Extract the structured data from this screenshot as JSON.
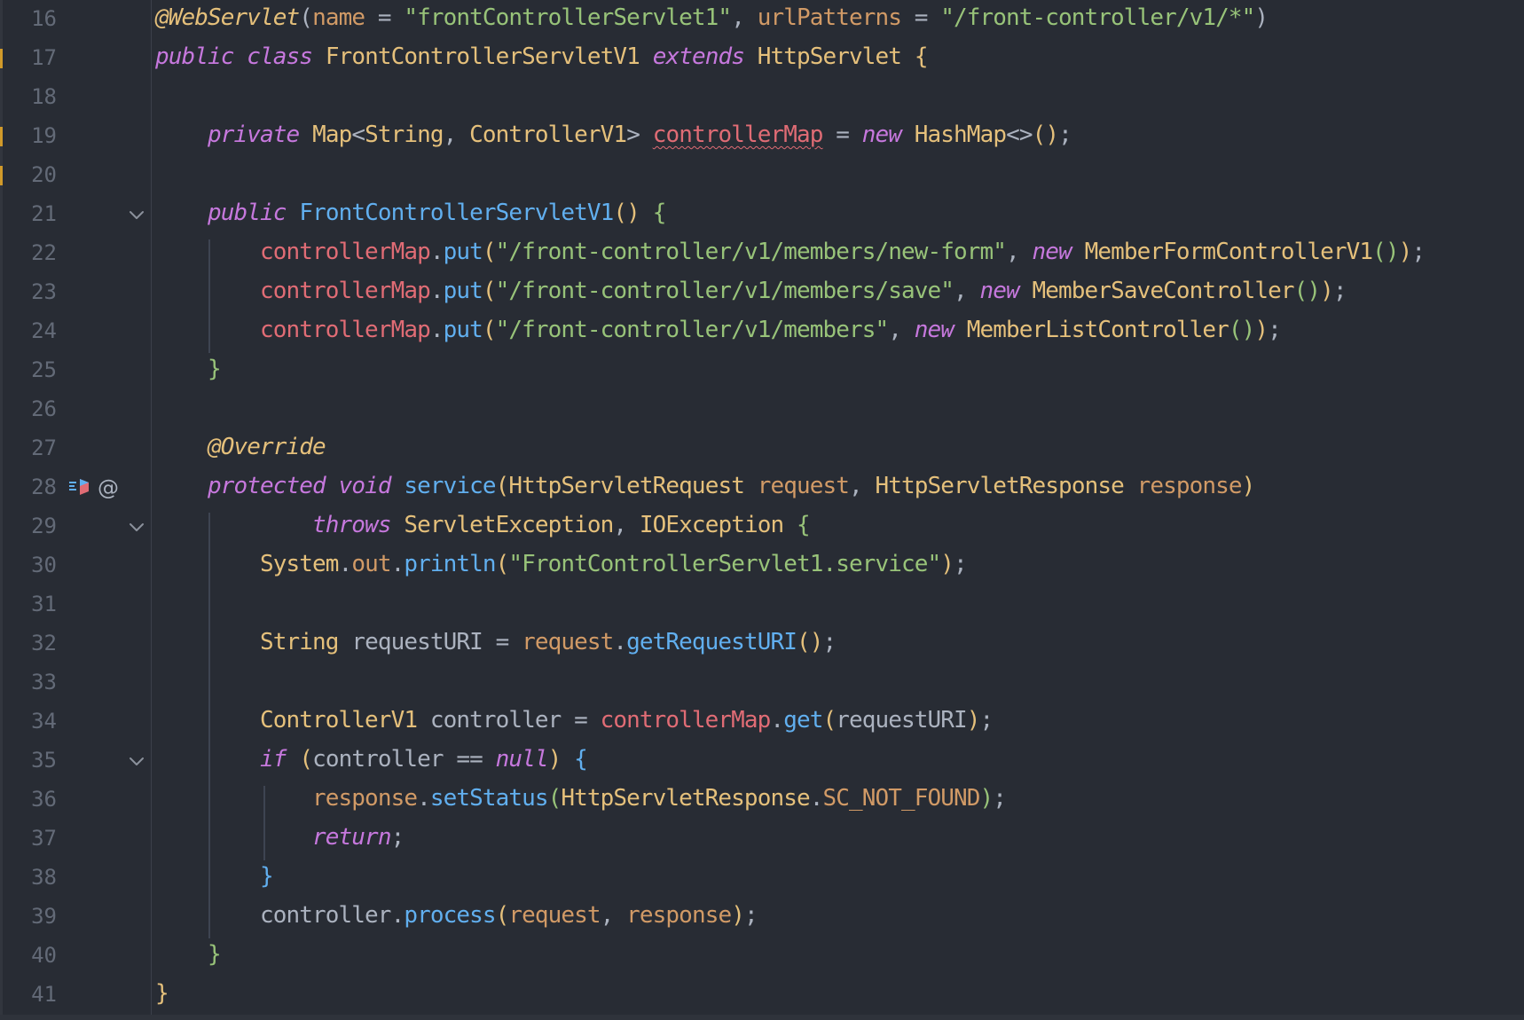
{
  "editor": {
    "language": "Java",
    "colors": {
      "background": "#282c34",
      "keyword": "#c678dd",
      "string": "#98c379",
      "class": "#e5c07b",
      "field": "#e06c75",
      "method": "#61afef",
      "parameter": "#d19a66",
      "line_number": "#636a77"
    },
    "lines": [
      {
        "number": "16",
        "tokens": [
          {
            "t": "@WebServlet",
            "c": "ann"
          },
          {
            "t": "(",
            "c": "plain"
          },
          {
            "t": "name",
            "c": "prm"
          },
          {
            "t": " = ",
            "c": "plain"
          },
          {
            "t": "\"frontControllerServlet1\"",
            "c": "str"
          },
          {
            "t": ", ",
            "c": "plain"
          },
          {
            "t": "urlPatterns",
            "c": "prm"
          },
          {
            "t": " = ",
            "c": "plain"
          },
          {
            "t": "\"/front-controller/v1/*\"",
            "c": "str"
          },
          {
            "t": ")",
            "c": "plain"
          }
        ]
      },
      {
        "number": "17",
        "tokens": [
          {
            "t": "public",
            "c": "kw"
          },
          {
            "t": " ",
            "c": "plain"
          },
          {
            "t": "class",
            "c": "kw"
          },
          {
            "t": " ",
            "c": "plain"
          },
          {
            "t": "FrontControllerServletV1",
            "c": "cls"
          },
          {
            "t": " ",
            "c": "plain"
          },
          {
            "t": "extends",
            "c": "kw"
          },
          {
            "t": " ",
            "c": "plain"
          },
          {
            "t": "HttpServlet",
            "c": "cls"
          },
          {
            "t": " ",
            "c": "plain"
          },
          {
            "t": "{",
            "c": "br1"
          }
        ]
      },
      {
        "number": "18",
        "tokens": []
      },
      {
        "number": "19",
        "tokens": [
          {
            "t": "    ",
            "c": "plain"
          },
          {
            "t": "private",
            "c": "kw"
          },
          {
            "t": " ",
            "c": "plain"
          },
          {
            "t": "Map",
            "c": "cls"
          },
          {
            "t": "<",
            "c": "plain"
          },
          {
            "t": "String",
            "c": "cls"
          },
          {
            "t": ", ",
            "c": "plain"
          },
          {
            "t": "ControllerV1",
            "c": "cls"
          },
          {
            "t": "> ",
            "c": "plain"
          },
          {
            "t": "controllerMap",
            "c": "fld squiggle"
          },
          {
            "t": " = ",
            "c": "plain"
          },
          {
            "t": "new",
            "c": "kw"
          },
          {
            "t": " ",
            "c": "plain"
          },
          {
            "t": "HashMap",
            "c": "cls"
          },
          {
            "t": "<>",
            "c": "plain"
          },
          {
            "t": "()",
            "c": "br1"
          },
          {
            "t": ";",
            "c": "plain"
          }
        ]
      },
      {
        "number": "20",
        "tokens": []
      },
      {
        "number": "21",
        "tokens": [
          {
            "t": "    ",
            "c": "plain"
          },
          {
            "t": "public",
            "c": "kw"
          },
          {
            "t": " ",
            "c": "plain"
          },
          {
            "t": "FrontControllerServletV1",
            "c": "fn"
          },
          {
            "t": "()",
            "c": "br1"
          },
          {
            "t": " ",
            "c": "plain"
          },
          {
            "t": "{",
            "c": "br2"
          }
        ]
      },
      {
        "number": "22",
        "tokens": [
          {
            "t": "        ",
            "c": "plain"
          },
          {
            "t": "controllerMap",
            "c": "fld"
          },
          {
            "t": ".",
            "c": "plain"
          },
          {
            "t": "put",
            "c": "fn"
          },
          {
            "t": "(",
            "c": "br1"
          },
          {
            "t": "\"/front-controller/v1/members/new-form\"",
            "c": "str"
          },
          {
            "t": ", ",
            "c": "plain"
          },
          {
            "t": "new",
            "c": "kw"
          },
          {
            "t": " ",
            "c": "plain"
          },
          {
            "t": "MemberFormControllerV1",
            "c": "cls"
          },
          {
            "t": "()",
            "c": "br2"
          },
          {
            "t": ")",
            "c": "br1"
          },
          {
            "t": ";",
            "c": "plain"
          }
        ]
      },
      {
        "number": "23",
        "tokens": [
          {
            "t": "        ",
            "c": "plain"
          },
          {
            "t": "controllerMap",
            "c": "fld"
          },
          {
            "t": ".",
            "c": "plain"
          },
          {
            "t": "put",
            "c": "fn"
          },
          {
            "t": "(",
            "c": "br1"
          },
          {
            "t": "\"/front-controller/v1/members/save\"",
            "c": "str"
          },
          {
            "t": ", ",
            "c": "plain"
          },
          {
            "t": "new",
            "c": "kw"
          },
          {
            "t": " ",
            "c": "plain"
          },
          {
            "t": "MemberSaveController",
            "c": "cls"
          },
          {
            "t": "()",
            "c": "br2"
          },
          {
            "t": ")",
            "c": "br1"
          },
          {
            "t": ";",
            "c": "plain"
          }
        ]
      },
      {
        "number": "24",
        "tokens": [
          {
            "t": "        ",
            "c": "plain"
          },
          {
            "t": "controllerMap",
            "c": "fld"
          },
          {
            "t": ".",
            "c": "plain"
          },
          {
            "t": "put",
            "c": "fn"
          },
          {
            "t": "(",
            "c": "br1"
          },
          {
            "t": "\"/front-controller/v1/members\"",
            "c": "str"
          },
          {
            "t": ", ",
            "c": "plain"
          },
          {
            "t": "new",
            "c": "kw"
          },
          {
            "t": " ",
            "c": "plain"
          },
          {
            "t": "MemberListController",
            "c": "cls"
          },
          {
            "t": "()",
            "c": "br2"
          },
          {
            "t": ")",
            "c": "br1"
          },
          {
            "t": ";",
            "c": "plain"
          }
        ]
      },
      {
        "number": "25",
        "tokens": [
          {
            "t": "    ",
            "c": "plain"
          },
          {
            "t": "}",
            "c": "br2"
          }
        ]
      },
      {
        "number": "26",
        "tokens": []
      },
      {
        "number": "27",
        "tokens": [
          {
            "t": "    ",
            "c": "plain"
          },
          {
            "t": "@Override",
            "c": "ann"
          }
        ]
      },
      {
        "number": "28",
        "tokens": [
          {
            "t": "    ",
            "c": "plain"
          },
          {
            "t": "protected",
            "c": "kw"
          },
          {
            "t": " ",
            "c": "plain"
          },
          {
            "t": "void",
            "c": "kw"
          },
          {
            "t": " ",
            "c": "plain"
          },
          {
            "t": "service",
            "c": "fn"
          },
          {
            "t": "(",
            "c": "br1"
          },
          {
            "t": "HttpServletRequest",
            "c": "cls"
          },
          {
            "t": " ",
            "c": "plain"
          },
          {
            "t": "request",
            "c": "prm"
          },
          {
            "t": ", ",
            "c": "plain"
          },
          {
            "t": "HttpServletResponse",
            "c": "cls"
          },
          {
            "t": " ",
            "c": "plain"
          },
          {
            "t": "response",
            "c": "prm"
          },
          {
            "t": ")",
            "c": "br1"
          }
        ]
      },
      {
        "number": "29",
        "tokens": [
          {
            "t": "            ",
            "c": "plain"
          },
          {
            "t": "throws",
            "c": "kw"
          },
          {
            "t": " ",
            "c": "plain"
          },
          {
            "t": "ServletException",
            "c": "cls"
          },
          {
            "t": ", ",
            "c": "plain"
          },
          {
            "t": "IOException",
            "c": "cls"
          },
          {
            "t": " ",
            "c": "plain"
          },
          {
            "t": "{",
            "c": "br2"
          }
        ]
      },
      {
        "number": "30",
        "tokens": [
          {
            "t": "        ",
            "c": "plain"
          },
          {
            "t": "System",
            "c": "cls"
          },
          {
            "t": ".",
            "c": "plain"
          },
          {
            "t": "out",
            "c": "prm"
          },
          {
            "t": ".",
            "c": "plain"
          },
          {
            "t": "println",
            "c": "fn"
          },
          {
            "t": "(",
            "c": "br1"
          },
          {
            "t": "\"FrontControllerServlet1.service\"",
            "c": "str"
          },
          {
            "t": ")",
            "c": "br1"
          },
          {
            "t": ";",
            "c": "plain"
          }
        ]
      },
      {
        "number": "31",
        "tokens": []
      },
      {
        "number": "32",
        "tokens": [
          {
            "t": "        ",
            "c": "plain"
          },
          {
            "t": "String",
            "c": "cls"
          },
          {
            "t": " requestURI = ",
            "c": "plain"
          },
          {
            "t": "request",
            "c": "prm"
          },
          {
            "t": ".",
            "c": "plain"
          },
          {
            "t": "getRequestURI",
            "c": "fn"
          },
          {
            "t": "()",
            "c": "br1"
          },
          {
            "t": ";",
            "c": "plain"
          }
        ]
      },
      {
        "number": "33",
        "tokens": []
      },
      {
        "number": "34",
        "tokens": [
          {
            "t": "        ",
            "c": "plain"
          },
          {
            "t": "ControllerV1",
            "c": "cls"
          },
          {
            "t": " controller = ",
            "c": "plain"
          },
          {
            "t": "controllerMap",
            "c": "fld"
          },
          {
            "t": ".",
            "c": "plain"
          },
          {
            "t": "get",
            "c": "fn"
          },
          {
            "t": "(",
            "c": "br1"
          },
          {
            "t": "requestURI",
            "c": "plain"
          },
          {
            "t": ")",
            "c": "br1"
          },
          {
            "t": ";",
            "c": "plain"
          }
        ]
      },
      {
        "number": "35",
        "tokens": [
          {
            "t": "        ",
            "c": "plain"
          },
          {
            "t": "if",
            "c": "kw"
          },
          {
            "t": " ",
            "c": "plain"
          },
          {
            "t": "(",
            "c": "br1"
          },
          {
            "t": "controller == ",
            "c": "plain"
          },
          {
            "t": "null",
            "c": "kw"
          },
          {
            "t": ")",
            "c": "br1"
          },
          {
            "t": " ",
            "c": "plain"
          },
          {
            "t": "{",
            "c": "br3"
          }
        ]
      },
      {
        "number": "36",
        "tokens": [
          {
            "t": "            ",
            "c": "plain"
          },
          {
            "t": "response",
            "c": "prm"
          },
          {
            "t": ".",
            "c": "plain"
          },
          {
            "t": "setStatus",
            "c": "fn"
          },
          {
            "t": "(",
            "c": "br2"
          },
          {
            "t": "HttpServletResponse",
            "c": "cls"
          },
          {
            "t": ".",
            "c": "plain"
          },
          {
            "t": "SC_NOT_FOUND",
            "c": "prm"
          },
          {
            "t": ")",
            "c": "br2"
          },
          {
            "t": ";",
            "c": "plain"
          }
        ]
      },
      {
        "number": "37",
        "tokens": [
          {
            "t": "            ",
            "c": "plain"
          },
          {
            "t": "return",
            "c": "kw"
          },
          {
            "t": ";",
            "c": "plain"
          }
        ]
      },
      {
        "number": "38",
        "tokens": [
          {
            "t": "        ",
            "c": "plain"
          },
          {
            "t": "}",
            "c": "br3"
          }
        ]
      },
      {
        "number": "39",
        "tokens": [
          {
            "t": "        ",
            "c": "plain"
          },
          {
            "t": "controller.",
            "c": "plain"
          },
          {
            "t": "process",
            "c": "fn"
          },
          {
            "t": "(",
            "c": "br1"
          },
          {
            "t": "request",
            "c": "prm"
          },
          {
            "t": ", ",
            "c": "plain"
          },
          {
            "t": "response",
            "c": "prm"
          },
          {
            "t": ")",
            "c": "br1"
          },
          {
            "t": ";",
            "c": "plain"
          }
        ]
      },
      {
        "number": "40",
        "tokens": [
          {
            "t": "    ",
            "c": "plain"
          },
          {
            "t": "}",
            "c": "br2"
          }
        ]
      },
      {
        "number": "41",
        "tokens": [
          {
            "t": "}",
            "c": "br1"
          }
        ]
      }
    ],
    "fold_markers": [
      "21",
      "29",
      "35"
    ],
    "change_markers": [
      "17",
      "19",
      "20"
    ],
    "gutter_icons": {
      "line": "28",
      "icons": [
        {
          "name": "implementation-icon",
          "glyph": "overrides-method"
        },
        {
          "name": "at-icon",
          "glyph": "@"
        }
      ]
    }
  }
}
